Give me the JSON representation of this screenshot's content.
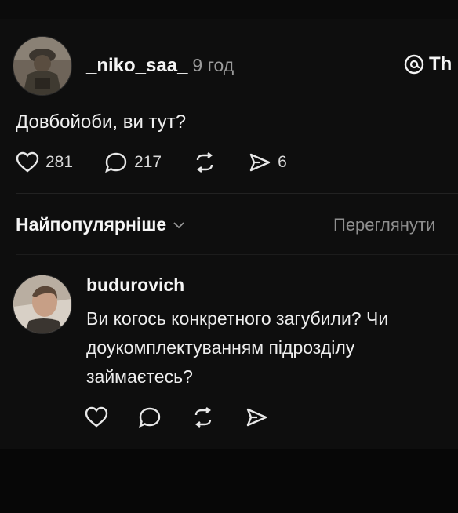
{
  "post": {
    "username": "_niko_saa_",
    "time": "9 год",
    "threads_label": "Th",
    "text": "Довбойоби, ви тут?",
    "likes": "281",
    "replies": "217",
    "shares": "6"
  },
  "sort": {
    "label": "Найпопулярніше",
    "view_all": "Переглянути"
  },
  "comment": {
    "username": "budurovich",
    "text": "Ви когось конкретного загубили? Чи доукомплектуванням підрозділу займаєтесь?"
  },
  "icons": {
    "like": "heart-icon",
    "reply": "comment-icon",
    "repost": "repost-icon",
    "share": "send-icon",
    "threads": "threads-logo-icon",
    "sort": "chevron-down-icon"
  },
  "colors": {
    "background": "#0e0e0e",
    "text": "#f2f2f2",
    "muted": "#9a9a9a"
  }
}
